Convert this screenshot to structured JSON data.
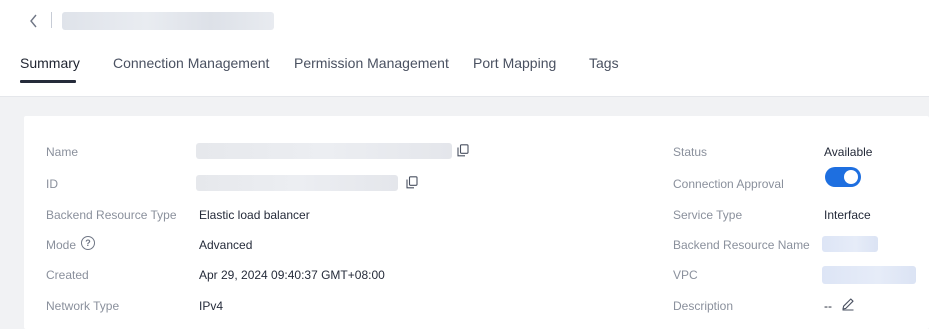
{
  "tabs": [
    "Summary",
    "Connection Management",
    "Permission Management",
    "Port Mapping",
    "Tags"
  ],
  "left": {
    "name_label": "Name",
    "id_label": "ID",
    "backend_type_label": "Backend Resource Type",
    "backend_type_value": "Elastic load balancer",
    "mode_label": "Mode",
    "mode_value": "Advanced",
    "created_label": "Created",
    "created_value": "Apr 29, 2024 09:40:37 GMT+08:00",
    "network_type_label": "Network Type",
    "network_type_value": "IPv4"
  },
  "right": {
    "status_label": "Status",
    "status_value": "Available",
    "approval_label": "Connection Approval",
    "approval_enabled": true,
    "service_type_label": "Service Type",
    "service_type_value": "Interface",
    "backend_name_label": "Backend Resource Name",
    "vpc_label": "VPC",
    "description_label": "Description",
    "description_value": "--"
  },
  "colors": {
    "accent": "#1e6fe0",
    "active_tab": "#252b3a"
  },
  "icons": {
    "back": "chevron-left-icon",
    "copy": "copy-icon",
    "help": "question-circle-icon",
    "edit": "pencil-icon"
  }
}
